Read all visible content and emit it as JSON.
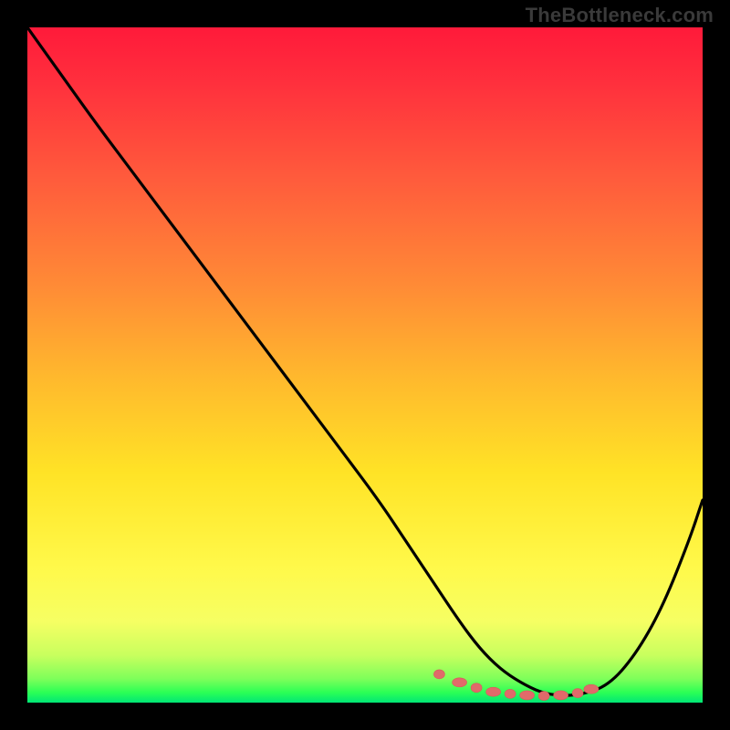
{
  "watermark": "TheBottleneck.com",
  "colors": {
    "gradient_top": "#ff1a3a",
    "gradient_mid1": "#ff8a36",
    "gradient_mid2": "#ffe326",
    "gradient_bottom": "#00e676",
    "curve": "#000000",
    "dots": "#e06a6a",
    "frame": "#000000"
  },
  "chart_data": {
    "type": "line",
    "title": "",
    "xlabel": "",
    "ylabel": "",
    "xlim": [
      0,
      100
    ],
    "ylim": [
      0,
      100
    ],
    "grid": false,
    "legend": false,
    "series": [
      {
        "name": "bottleneck-curve",
        "x": [
          0,
          5,
          10,
          16,
          22,
          28,
          34,
          40,
          46,
          52,
          56,
          60,
          64,
          67,
          70,
          73,
          76,
          79,
          82,
          86,
          90,
          94,
          98,
          100
        ],
        "y": [
          100,
          93,
          86,
          78,
          70,
          62,
          54,
          46,
          38,
          30,
          24,
          18,
          12,
          8,
          5,
          3,
          1.5,
          1,
          1.2,
          2.5,
          7,
          14,
          24,
          30
        ]
      }
    ],
    "highlight_points": {
      "name": "optimal-zone-dots",
      "x": [
        61,
        64,
        66.5,
        69,
        71.5,
        74,
        76.5,
        79,
        81.5,
        83.5
      ],
      "y": [
        4.2,
        3.0,
        2.2,
        1.6,
        1.3,
        1.1,
        1.0,
        1.1,
        1.4,
        2.0
      ]
    }
  }
}
